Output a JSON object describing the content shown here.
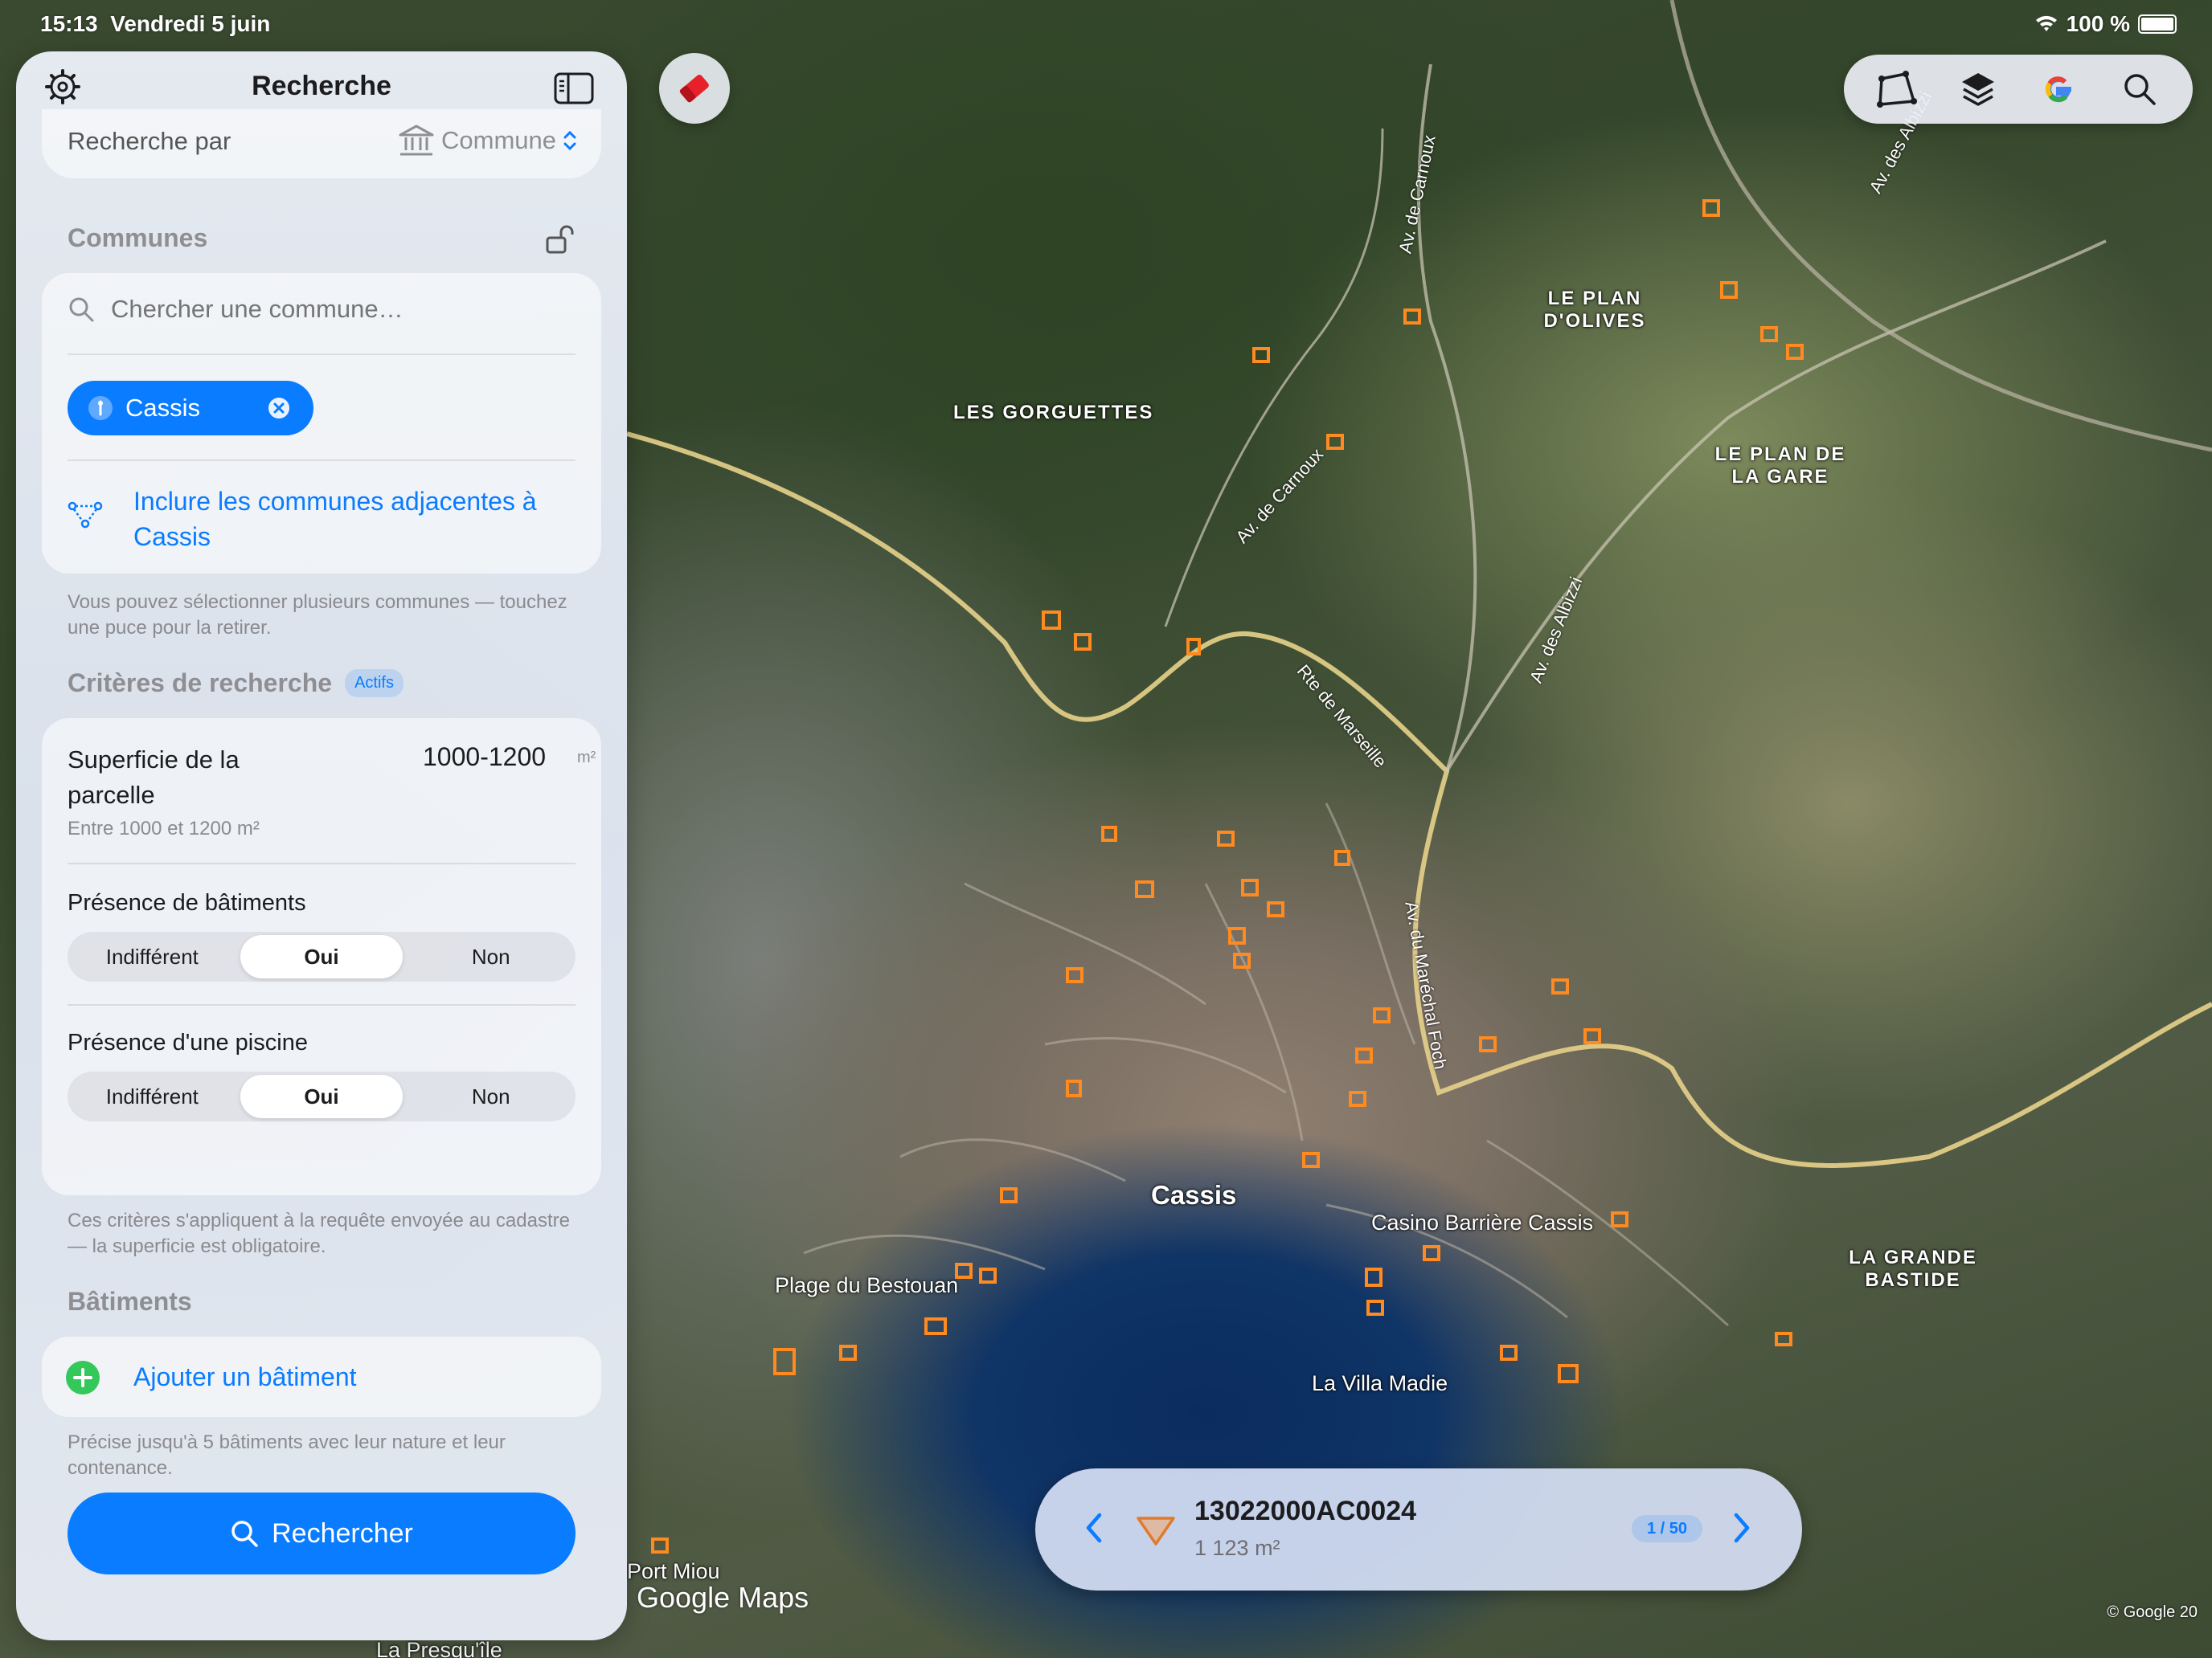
{
  "status_bar": {
    "time": "15:13",
    "date": "Vendredi 5 juin",
    "battery": "100 %"
  },
  "sidebar": {
    "title": "Recherche",
    "search_by": {
      "label": "Recherche par",
      "value": "Commune"
    },
    "communes": {
      "title": "Communes",
      "placeholder": "Chercher une commune…",
      "chips": [
        {
          "label": "Cassis"
        }
      ],
      "include_adjacent": "Inclure les communes adjacentes à Cassis",
      "footnote": "Vous pouvez sélectionner plusieurs communes — touchez une puce pour la retirer."
    },
    "criteria": {
      "title": "Critères de recherche",
      "badge": "Actifs",
      "area": {
        "label": "Superficie de la parcelle",
        "value": "1000-1200",
        "unit": "m²",
        "sublabel": "Entre 1000 et 1200 m²"
      },
      "buildings": {
        "label": "Présence de bâtiments",
        "options": [
          "Indifférent",
          "Oui",
          "Non"
        ],
        "selected": "Oui"
      },
      "pool": {
        "label": "Présence d'une piscine",
        "options": [
          "Indifférent",
          "Oui",
          "Non"
        ],
        "selected": "Oui"
      },
      "footnote": "Ces critères s'appliquent à la requête envoyée au cadastre — la superficie est obligatoire."
    },
    "batiments": {
      "title": "Bâtiments",
      "add_label": "Ajouter un bâtiment",
      "footnote": "Précise jusqu'à 5 bâtiments avec leur nature et leur contenance."
    },
    "search_button": "Rechercher"
  },
  "map": {
    "labels": {
      "les_gorguettes": "LES GORGUETTES",
      "plan_olives": "LE PLAN D'OLIVES",
      "plan_gare": "LE PLAN DE LA GARE",
      "grande_bastide": "LA GRANDE BASTIDE",
      "cassis": "Cassis",
      "casino": "Casino Barrière Cassis",
      "bestouan": "Plage du Bestouan",
      "villa_madie": "La Villa Madie",
      "port_miou": "Port Miou",
      "presquile": "La Presqu'île"
    },
    "roads": {
      "av_carnoux_1": "Av. de Carnoux",
      "av_carnoux_2": "Av. de Carnoux",
      "rte_marseille": "Rte de Marseille",
      "av_albizzi_1": "Av. des Albizzi",
      "av_albizzi_2": "Av. des Albizzi",
      "av_foch": "Av. du Maréchal Foch"
    },
    "attribution": "Google Maps",
    "copyright": "© Google 20"
  },
  "result": {
    "id": "13022000AC0024",
    "area": "1 123 m²",
    "pager": "1 / 50"
  },
  "colors": {
    "accent": "#0a7cff",
    "parcel": "#ff8a1f",
    "map_water": "#0f3466"
  }
}
